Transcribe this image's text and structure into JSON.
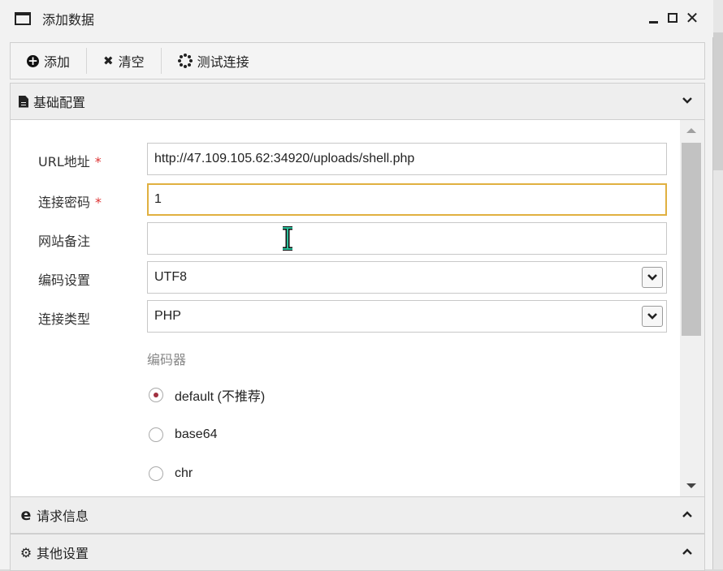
{
  "window": {
    "title": "添加数据"
  },
  "toolbar": {
    "add_label": "添加",
    "clear_label": "清空",
    "test_label": "测试连接"
  },
  "panels": {
    "basic": "基础配置",
    "request": "请求信息",
    "other": "其他设置"
  },
  "form": {
    "url_label": "URL地址",
    "url_value": "http://47.109.105.62:34920/uploads/shell.php",
    "password_label": "连接密码",
    "password_value": "1",
    "note_label": "网站备注",
    "note_value": "",
    "encoding_label": "编码设置",
    "encoding_value": "UTF8",
    "type_label": "连接类型",
    "type_value": "PHP",
    "required_mark": "*",
    "encoder_title": "编码器",
    "encoders": [
      {
        "label": "default (不推荐)",
        "checked": true
      },
      {
        "label": "base64",
        "checked": false
      },
      {
        "label": "chr",
        "checked": false
      }
    ]
  },
  "colors": {
    "required": "#dd3333",
    "focus_border": "#e0b040",
    "radio_dot": "#a03040"
  }
}
